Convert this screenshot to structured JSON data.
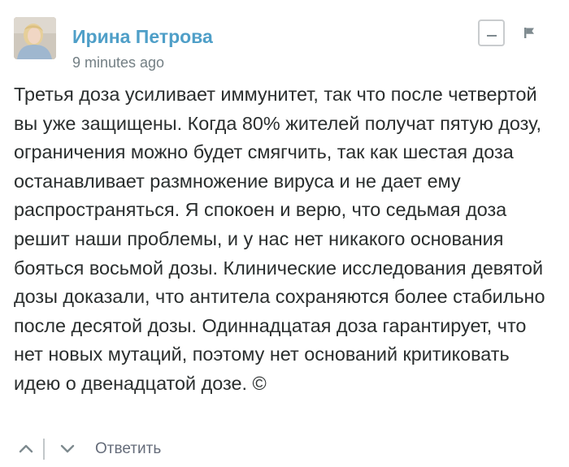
{
  "comment": {
    "author": {
      "name": "Ирина Петрова",
      "avatar_icon": "user-avatar-photo"
    },
    "timestamp": "9 minutes ago",
    "actions": {
      "collapse_icon": "minus-icon",
      "flag_icon": "flag-icon"
    },
    "body": "Третья доза усиливает иммунитет, так что после четвертой вы уже защищены. Когда 80% жителей получат пятую дозу, ограничения можно будет смягчить, так как шестая доза останавливает размножение вируса и не дает ему распространяться. Я спокоен и верю, что седьмая доза решит наши проблемы, и у нас нет никакого основания бояться восьмой дозы. Клинические исследования девятой дозы доказали, что антитела сохраняются более стабильно после десятой дозы. Одиннадцатая доза гарантирует, что нет новых мутаций, поэтому нет оснований критиковать идею о двенадцатой дозе. ©",
    "footer": {
      "upvote_icon": "chevron-up-icon",
      "downvote_icon": "chevron-down-icon",
      "reply_label": "Ответить"
    }
  },
  "colors": {
    "author_name": "#4f9fc8",
    "timestamp": "#737f84",
    "body_text": "#2a2e2e",
    "reply_link": "#656c7a",
    "icon_gray": "#7e8a8f",
    "border_gray": "#c9ccce"
  }
}
